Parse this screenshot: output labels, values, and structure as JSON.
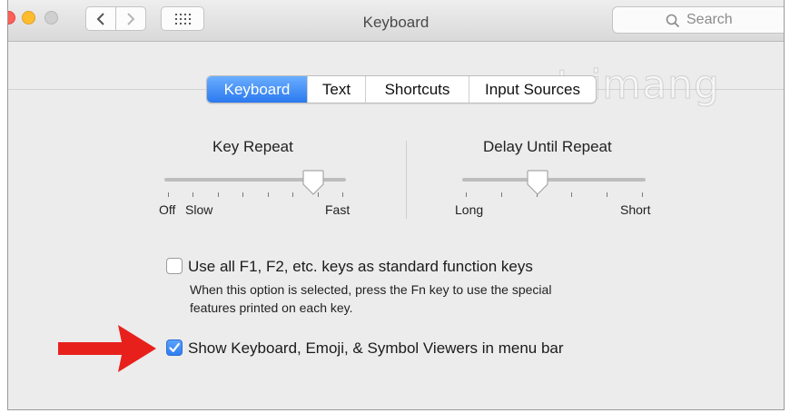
{
  "window": {
    "title": "Keyboard",
    "search": {
      "placeholder": "Search"
    }
  },
  "tabs": [
    {
      "label": "Keyboard",
      "active": true
    },
    {
      "label": "Text",
      "active": false
    },
    {
      "label": "Shortcuts",
      "active": false
    },
    {
      "label": "Input Sources",
      "active": false
    }
  ],
  "key_repeat": {
    "title": "Key Repeat",
    "min_label": "Off",
    "slow_label": "Slow",
    "max_label": "Fast",
    "value_fraction": 0.82
  },
  "delay_until_repeat": {
    "title": "Delay Until Repeat",
    "min_label": "Long",
    "max_label": "Short",
    "value_fraction": 0.41
  },
  "options": {
    "fn_keys": {
      "label": "Use all F1, F2, etc. keys as standard function keys",
      "checked": false,
      "note_line1": "When this option is selected, press the Fn key to use the special",
      "note_line2": "features printed on each key."
    },
    "viewers": {
      "label": "Show Keyboard, Emoji, & Symbol Viewers in menu bar",
      "checked": true
    }
  },
  "watermark": {
    "text": "uantrimang"
  },
  "colors": {
    "accent": "#2b79ef",
    "arrow": "#e8201c"
  },
  "icons": [
    "chevron-left-icon",
    "chevron-right-icon",
    "grid-icon",
    "search-icon",
    "checkmark-icon",
    "red-arrow-icon"
  ]
}
